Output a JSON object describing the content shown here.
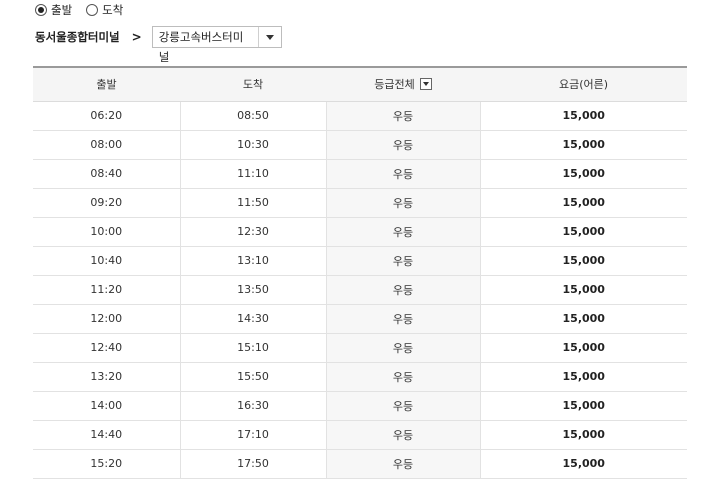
{
  "direction": {
    "options": [
      {
        "label": "출발",
        "selected": true
      },
      {
        "label": "도착",
        "selected": false
      }
    ]
  },
  "route": {
    "origin": "동서울종합터미널",
    "arrow": ">",
    "destination": "강릉고속버스터미널"
  },
  "table": {
    "headers": {
      "departure": "출발",
      "arrival": "도착",
      "grade": "등급전체",
      "fare": "요금(어른)"
    },
    "rows": [
      {
        "departure": "06:20",
        "arrival": "08:50",
        "grade": "우등",
        "fare": "15,000"
      },
      {
        "departure": "08:00",
        "arrival": "10:30",
        "grade": "우등",
        "fare": "15,000"
      },
      {
        "departure": "08:40",
        "arrival": "11:10",
        "grade": "우등",
        "fare": "15,000"
      },
      {
        "departure": "09:20",
        "arrival": "11:50",
        "grade": "우등",
        "fare": "15,000"
      },
      {
        "departure": "10:00",
        "arrival": "12:30",
        "grade": "우등",
        "fare": "15,000"
      },
      {
        "departure": "10:40",
        "arrival": "13:10",
        "grade": "우등",
        "fare": "15,000"
      },
      {
        "departure": "11:20",
        "arrival": "13:50",
        "grade": "우등",
        "fare": "15,000"
      },
      {
        "departure": "12:00",
        "arrival": "14:30",
        "grade": "우등",
        "fare": "15,000"
      },
      {
        "departure": "12:40",
        "arrival": "15:10",
        "grade": "우등",
        "fare": "15,000"
      },
      {
        "departure": "13:20",
        "arrival": "15:50",
        "grade": "우등",
        "fare": "15,000"
      },
      {
        "departure": "14:00",
        "arrival": "16:30",
        "grade": "우등",
        "fare": "15,000"
      },
      {
        "departure": "14:40",
        "arrival": "17:10",
        "grade": "우등",
        "fare": "15,000"
      },
      {
        "departure": "15:20",
        "arrival": "17:50",
        "grade": "우등",
        "fare": "15,000"
      }
    ]
  }
}
